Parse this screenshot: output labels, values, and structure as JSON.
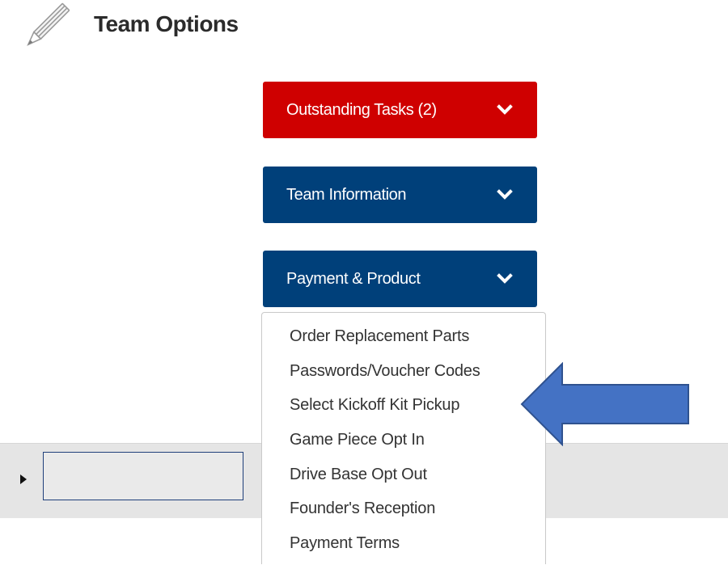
{
  "header": {
    "title": "Team Options",
    "icon": "pencil-icon"
  },
  "accordion": {
    "outstanding_tasks": {
      "label": "Outstanding Tasks (2)",
      "color": "#cf0000",
      "icon": "chevron-down-icon"
    },
    "team_information": {
      "label": "Team Information",
      "color": "#00407a",
      "icon": "chevron-down-icon"
    },
    "payment_product": {
      "label": "Payment & Product",
      "color": "#00407a",
      "icon": "chevron-down-icon",
      "expanded": true,
      "items": [
        {
          "label": "Order Replacement Parts"
        },
        {
          "label": "Passwords/Voucher Codes"
        },
        {
          "label": "Select Kickoff Kit Pickup"
        },
        {
          "label": "Game Piece Opt In"
        },
        {
          "label": "Drive Base Opt Out"
        },
        {
          "label": "Founder's Reception"
        },
        {
          "label": "Payment Terms"
        }
      ]
    }
  },
  "annotation": {
    "arrow_color": "#4472c4",
    "arrow_icon": "arrow-left-icon"
  },
  "row": {
    "caret_icon": "caret-right-icon",
    "input_value": ""
  }
}
